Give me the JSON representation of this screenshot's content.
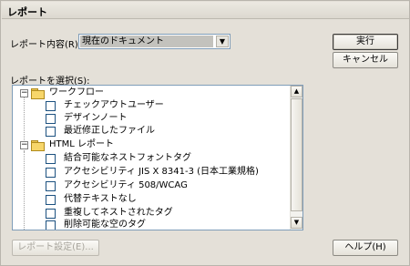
{
  "window": {
    "title": "レポート"
  },
  "report_scope": {
    "label": "レポート内容(R):",
    "selected": "現在のドキュメント"
  },
  "report_select_label": "レポートを選択(S):",
  "tree": {
    "groups": [
      {
        "label": "ワークフロー",
        "items": [
          "チェックアウトユーザー",
          "デザインノート",
          "最近修正したファイル"
        ]
      },
      {
        "label": "HTML レポート",
        "items": [
          "結合可能なネストフォントタグ",
          "アクセシビリティ JIS X 8341-3 (日本工業規格)",
          "アクセシビリティ 508/WCAG",
          "代替テキストなし",
          "重複してネストされたタグ",
          "削除可能な空のタグ"
        ]
      }
    ]
  },
  "buttons": {
    "run": "実行",
    "cancel": "キャンセル",
    "report_settings": "レポート設定(E)...",
    "help": "ヘルプ(H)"
  }
}
